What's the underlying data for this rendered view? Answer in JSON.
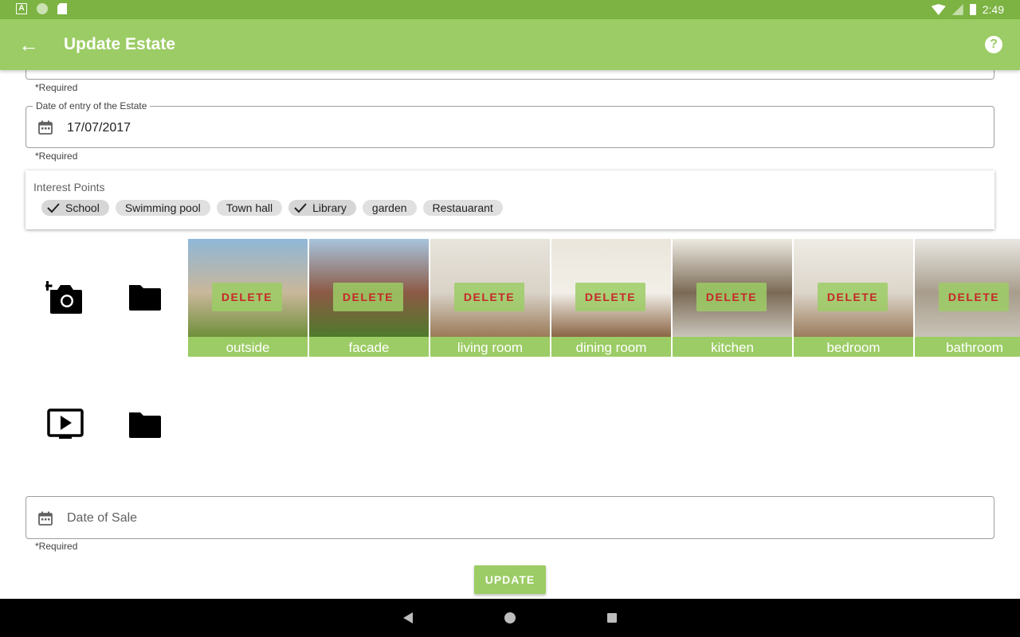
{
  "status_bar": {
    "time": "2:49",
    "left_icons": [
      "a-notification-icon",
      "circle-notification-icon",
      "sd-card-icon"
    ],
    "right_icons": [
      "wifi-icon",
      "signal-icon",
      "battery-icon"
    ]
  },
  "app_bar": {
    "title": "Update Estate",
    "back_icon": "arrow-back-icon",
    "help_icon": "help-icon",
    "help_glyph": "?",
    "back_glyph": "←"
  },
  "form": {
    "top_field_required": "*Required",
    "entry_date": {
      "label": "Date of entry of the Estate",
      "value": "17/07/2017",
      "required": "*Required"
    },
    "interest_points": {
      "label": "Interest Points",
      "chips": [
        {
          "label": "School",
          "checked": true
        },
        {
          "label": "Swimming pool",
          "checked": false
        },
        {
          "label": "Town hall",
          "checked": false
        },
        {
          "label": "Library",
          "checked": true
        },
        {
          "label": "garden",
          "checked": false
        },
        {
          "label": "Restauarant",
          "checked": false
        }
      ]
    },
    "sale_date": {
      "placeholder": "Date of Sale",
      "required": "*Required"
    }
  },
  "media": {
    "add_photo_icon": "add-photo-camera-icon",
    "photo_folder_icon": "folder-icon",
    "video_icon": "video-play-icon",
    "video_folder_icon": "folder-icon",
    "delete_label": "DELETE",
    "photos": [
      {
        "caption": "outside",
        "colors": [
          "#8fb7d8",
          "#6f8f3a",
          "#c9b79a"
        ]
      },
      {
        "caption": "facade",
        "colors": [
          "#a7c4dd",
          "#4f7a2c",
          "#8c5a45"
        ]
      },
      {
        "caption": "living room",
        "colors": [
          "#e8e4dc",
          "#9a7a58",
          "#d9d2c7"
        ]
      },
      {
        "caption": "dining room",
        "colors": [
          "#ebe6dc",
          "#8a6545",
          "#f2efe8"
        ]
      },
      {
        "caption": "kitchen",
        "colors": [
          "#eeeae2",
          "#c9c4ba",
          "#7a6a55"
        ]
      },
      {
        "caption": "bedroom",
        "colors": [
          "#efece6",
          "#9b7c5c",
          "#dcd5c9"
        ]
      },
      {
        "caption": "bathroom",
        "colors": [
          "#e9e7e2",
          "#c8c2b6",
          "#a89d8c"
        ]
      }
    ]
  },
  "update_button": "UPDATE",
  "nav_bar": {
    "back_icon": "nav-back-icon",
    "home_icon": "nav-home-icon",
    "recents_icon": "nav-recents-icon"
  },
  "colors": {
    "status_bar": "#7cb342",
    "primary": "#9ccc65",
    "delete_text": "#c62828"
  }
}
